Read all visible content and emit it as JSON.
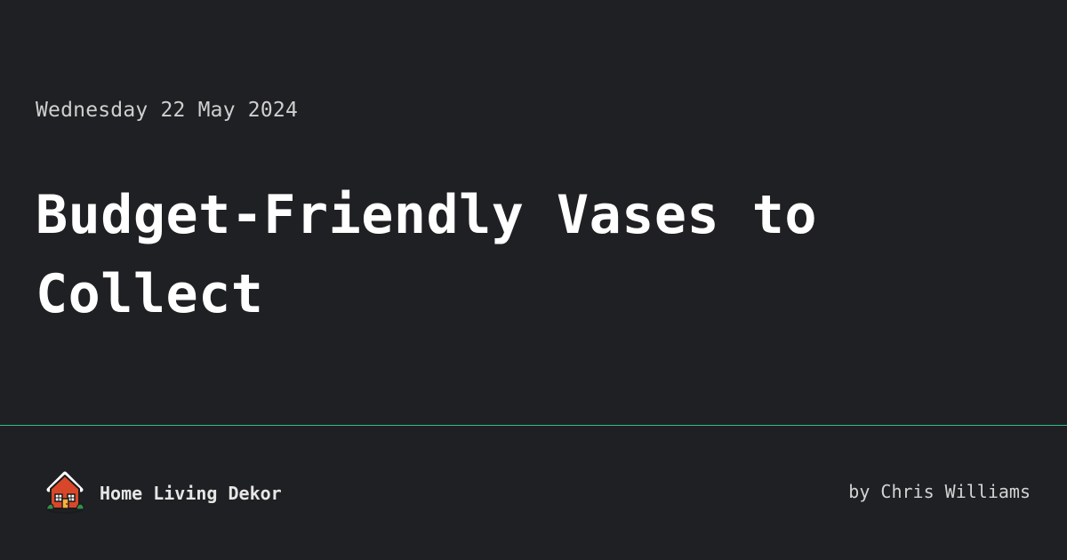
{
  "post": {
    "date": "Wednesday 22 May 2024",
    "title_line_1": "Budget-Friendly Vases to",
    "title_line_2": "Collect",
    "author": "by Chris Williams"
  },
  "footer": {
    "site_name": "Home Living Dekor",
    "logo_icon": "house-icon"
  },
  "colors": {
    "background": "#1f2023",
    "divider": "#2fbf8a",
    "text": "#ffffff",
    "muted_text": "#cfcfcf",
    "logo_roof": "#d9472b",
    "logo_trim": "#ffffff",
    "logo_plants": "#2f8f4e"
  }
}
